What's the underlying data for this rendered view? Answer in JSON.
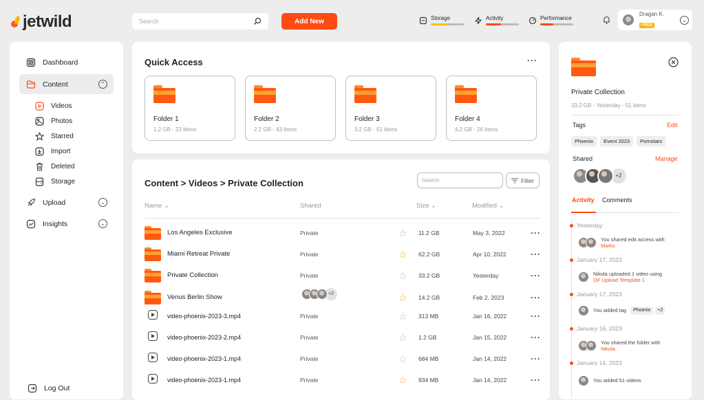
{
  "brand": {
    "name": "jetwild"
  },
  "topbar": {
    "search_placeholder": "Search",
    "add_new_label": "Add New",
    "stats": [
      {
        "label": "Storage",
        "progress": 0.5,
        "color": "#ffc300"
      },
      {
        "label": "Activity",
        "progress": 0.45,
        "color": "#ff4a10"
      },
      {
        "label": "Performance",
        "progress": 0.4,
        "color": "#ff4a10"
      }
    ],
    "user": {
      "name": "Dragan K.",
      "plan": "FREE"
    }
  },
  "sidebar": {
    "items": [
      {
        "label": "Dashboard",
        "icon": "dashboard-icon"
      },
      {
        "label": "Content",
        "icon": "folder-icon",
        "active": true
      },
      {
        "label": "Upload",
        "icon": "rocket-icon"
      },
      {
        "label": "Insights",
        "icon": "chart-icon"
      }
    ],
    "sub_items": [
      {
        "label": "Videos",
        "icon": "video-icon"
      },
      {
        "label": "Photos",
        "icon": "image-icon"
      },
      {
        "label": "Starred",
        "icon": "star-icon"
      },
      {
        "label": "Import",
        "icon": "import-icon"
      },
      {
        "label": "Deleted",
        "icon": "trash-icon"
      },
      {
        "label": "Storage",
        "icon": "storage-icon"
      }
    ],
    "logout_label": "Log Out"
  },
  "quick_access": {
    "title": "Quick Access",
    "folders": [
      {
        "name": "Folder 1",
        "meta": "1.2 GB - 23 items"
      },
      {
        "name": "Folder 2",
        "meta": "2.2 GB - 43 items"
      },
      {
        "name": "Folder 3",
        "meta": "3.2 GB - 51 items"
      },
      {
        "name": "Folder 4",
        "meta": "4.2 GB - 26 items"
      }
    ]
  },
  "content": {
    "breadcrumb": "Content > Videos > Private Collection",
    "search_placeholder": "Search",
    "filter_label": "Filter",
    "columns": {
      "name": "Name",
      "shared": "Shared",
      "size": "Size",
      "modified": "Modified"
    },
    "rows": [
      {
        "type": "folder",
        "name": "Los Angeles  Exclusive",
        "shared": "Private",
        "starred": false,
        "size": "11.2 GB",
        "modified": "May 3, 2022"
      },
      {
        "type": "folder",
        "name": "Miami Retreat Private",
        "shared": "Private",
        "starred": true,
        "size": "62.2 GB",
        "modified": "Apr 10, 2022"
      },
      {
        "type": "folder",
        "name": "Private Collection",
        "shared": "Private",
        "starred": false,
        "size": "33.2 GB",
        "modified": "Yesterday"
      },
      {
        "type": "folder",
        "name": "Venus Berlin Show",
        "shared": "+2",
        "starred": true,
        "size": "14.2 GB",
        "modified": "Feb 2, 2023"
      },
      {
        "type": "video",
        "name": "video-phoenix-2023-3.mp4",
        "shared": "Private",
        "starred": false,
        "size": "313 MB",
        "modified": "Jan 16, 2022"
      },
      {
        "type": "video",
        "name": "video-phoenix-2023-2.mp4",
        "shared": "Private",
        "starred": false,
        "size": "1.2 GB",
        "modified": "Jan 15, 2022"
      },
      {
        "type": "video",
        "name": "video-phoenix-2023-1.mp4",
        "shared": "Private",
        "starred": false,
        "size": "684 MB",
        "modified": "Jan 14, 2022"
      },
      {
        "type": "video",
        "name": "video-phoenix-2023-1.mp4",
        "shared": "Private",
        "starred": true,
        "size": "934 MB",
        "modified": "Jan 14, 2022"
      }
    ]
  },
  "details": {
    "title": "Private Collection",
    "meta": "33.2 GB - Yesterday - 51 items",
    "tags_label": "Tags",
    "edit_label": "Edit",
    "tags": [
      "Phoenix",
      "Event 2023",
      "Pornstars"
    ],
    "shared_label": "Shared",
    "manage_label": "Manage",
    "shared_more": "+2",
    "tabs": [
      "Activity",
      "Comments"
    ],
    "timeline": [
      {
        "date": "Yesterday",
        "text": "You shared edit access with",
        "highlight": "Marko"
      },
      {
        "date": "January 17, 2023",
        "text": "Nikola uploaded 1 video using",
        "highlight": "OF Upload Template 1"
      },
      {
        "date": "January 17, 2023",
        "text": "You added tag",
        "tag": "Phoenix",
        "more": "+2"
      },
      {
        "date": "January 16, 2023",
        "text": "You shared the folder with",
        "highlight": "Nikola"
      },
      {
        "date": "January 14, 2023",
        "text": "You added 51 videos"
      }
    ]
  }
}
